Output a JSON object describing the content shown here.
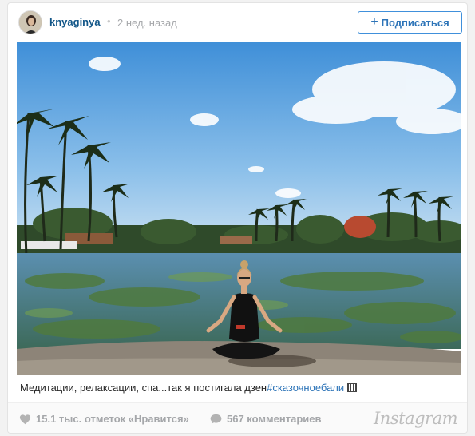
{
  "header": {
    "username": "knyaginya",
    "separator": "•",
    "time_ago": "2 нед. назад",
    "follow_plus": "+",
    "follow_label": "Подписаться"
  },
  "caption": {
    "text": "Медитации, релаксации, спа...так я постигала дзен",
    "hashtag": "#сказочноебали"
  },
  "footer": {
    "likes": "15.1 тыс. отметок «Нравится»",
    "comments": "567 комментариев",
    "brand": "Instagram"
  },
  "colors": {
    "link": "#125688",
    "button_border": "#4090db",
    "muted": "#a5a7aa"
  },
  "icons": [
    "heart-icon",
    "comment-bubble-icon",
    "plus-icon"
  ]
}
